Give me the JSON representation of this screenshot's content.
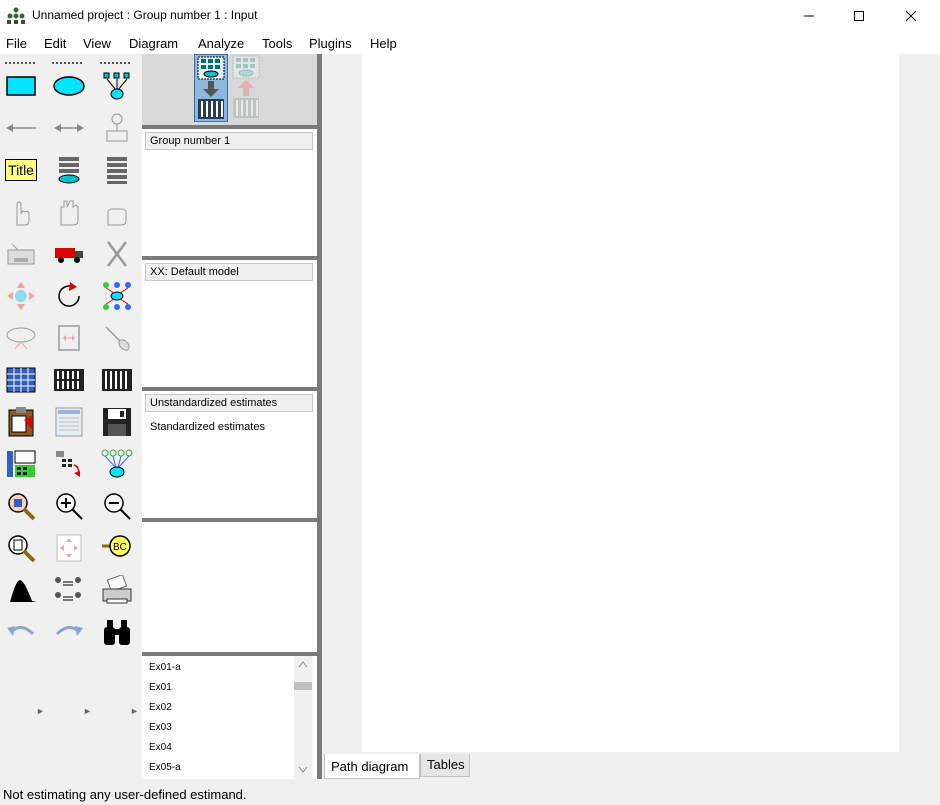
{
  "window": {
    "title": "Unnamed project : Group number 1 : Input"
  },
  "menu": [
    "File",
    "Edit",
    "View",
    "Diagram",
    "Analyze",
    "Tools",
    "Plugins",
    "Help"
  ],
  "panels": {
    "groups": {
      "header": "Group number 1"
    },
    "models": {
      "header": "XX: Default model"
    },
    "estimates": {
      "selected": "Unstandardized estimates",
      "other": "Standardized estimates"
    }
  },
  "model_list": [
    "Ex01-a",
    "Ex01",
    "Ex02",
    "Ex03",
    "Ex04",
    "Ex05-a"
  ],
  "tabs": {
    "path_diagram": "Path diagram",
    "tables": "Tables"
  },
  "status": {
    "message": "Not estimating any user-defined estimand."
  },
  "icons": {
    "tool_title": "Title"
  },
  "colors": {
    "accent_cyan": "#00e5ff",
    "input_view_highlight": "#8fb8de"
  }
}
